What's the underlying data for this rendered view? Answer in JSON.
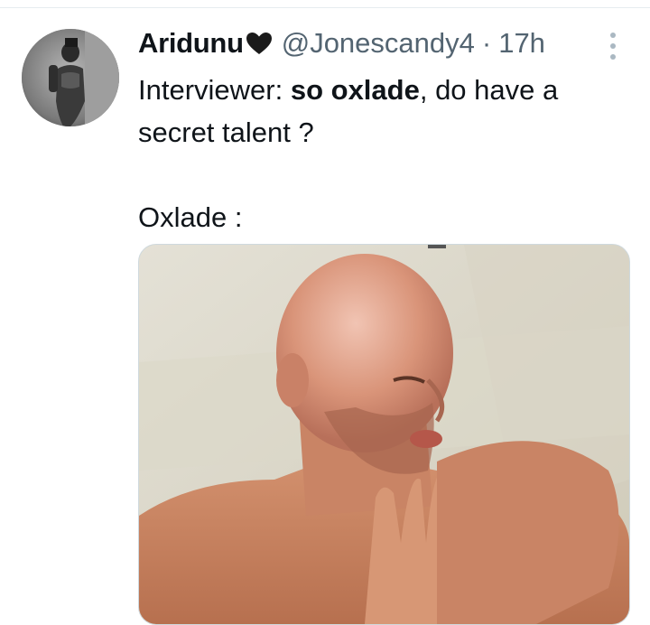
{
  "tweet": {
    "display_name": "Aridunu",
    "handle": "@Jonescandy4",
    "separator": "·",
    "time": "17h",
    "text": {
      "line1_prefix": "Interviewer: ",
      "line1_bold": "so oxlade",
      "line1_suffix": ", do have a",
      "line2": "secret talent ?",
      "line3": "Oxlade :"
    },
    "icons": {
      "name_emoji": "heart-icon",
      "overflow": "more-options-icon"
    },
    "colors": {
      "name": "#0f1419",
      "meta": "#536471",
      "divider": "#e6ecf0"
    }
  }
}
